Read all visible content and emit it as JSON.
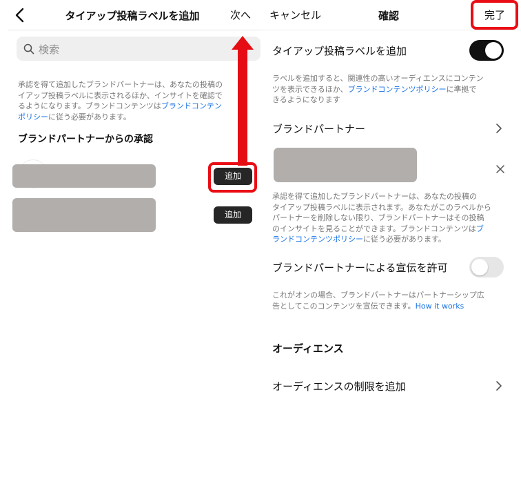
{
  "left_screen": {
    "header": {
      "title": "タイアップ投稿ラベルを追加",
      "next_label": "次へ"
    },
    "search": {
      "placeholder": "検索"
    },
    "description": {
      "line1": "承認を得て追加したブランドパートナーは、あなたの投稿の",
      "line2": "イアップ投稿ラベルに表示されるほか、インサイトを確認で",
      "line3_text": "るようになります。ブランドコンテンツは",
      "line3_link": "ブランドコンテン",
      "line4_link": "ポリシー",
      "line4_text": "に従う必要があります。"
    },
    "section_title": "ブランドパートナーからの承認",
    "partners": [
      {
        "add_label": "追加"
      },
      {
        "add_label": "追加"
      }
    ]
  },
  "right_screen": {
    "header": {
      "cancel_label": "キャンセル",
      "title": "確認",
      "done_label": "完了"
    },
    "paid_partnership": {
      "label": "タイアップ投稿ラベルを追加",
      "enabled": true,
      "desc_line1": "ラベルを追加すると、関連性の高いオーディエンスにコンテン",
      "desc_line2_text": "ツを表示できるほか、",
      "desc_line2_link": "ブランドコンテンツポリシー",
      "desc_line2_tail": "に準拠で",
      "desc_line3": "きるようになります"
    },
    "brand_partner": {
      "label": "ブランドパートナー",
      "desc_line1": "承認を得て追加したブランドパートナーは、あなたの投稿の",
      "desc_line2": "タイアップ投稿ラベルに表示されます。あなたがこのラベルから",
      "desc_line3": "パートナーを削除しない限り、ブランドパートナーはその投稿",
      "desc_line4_text": "のインサイトを見ることができます。ブランドコンテンツは",
      "desc_line4_link": "ブ",
      "desc_line5_link": "ランドコンテンツポリシー",
      "desc_line5_text": "に従う必要があります。"
    },
    "allow_promote": {
      "label": "ブランドパートナーによる宣伝を許可",
      "enabled": false,
      "desc_line1": "これがオンの場合、ブランドパートナーはパートナーシップ広",
      "desc_line2_text": "告としてこのコンテンツを宣伝できます。",
      "desc_line2_link": "How it works"
    },
    "audience": {
      "section_title": "オーディエンス",
      "restriction_label": "オーディエンスの制限を追加"
    }
  },
  "colors": {
    "annotation_red": "#e50d13",
    "link_blue": "#1a73e8",
    "button_dark": "#262626",
    "placeholder_gray_block": "#b2aeac"
  }
}
